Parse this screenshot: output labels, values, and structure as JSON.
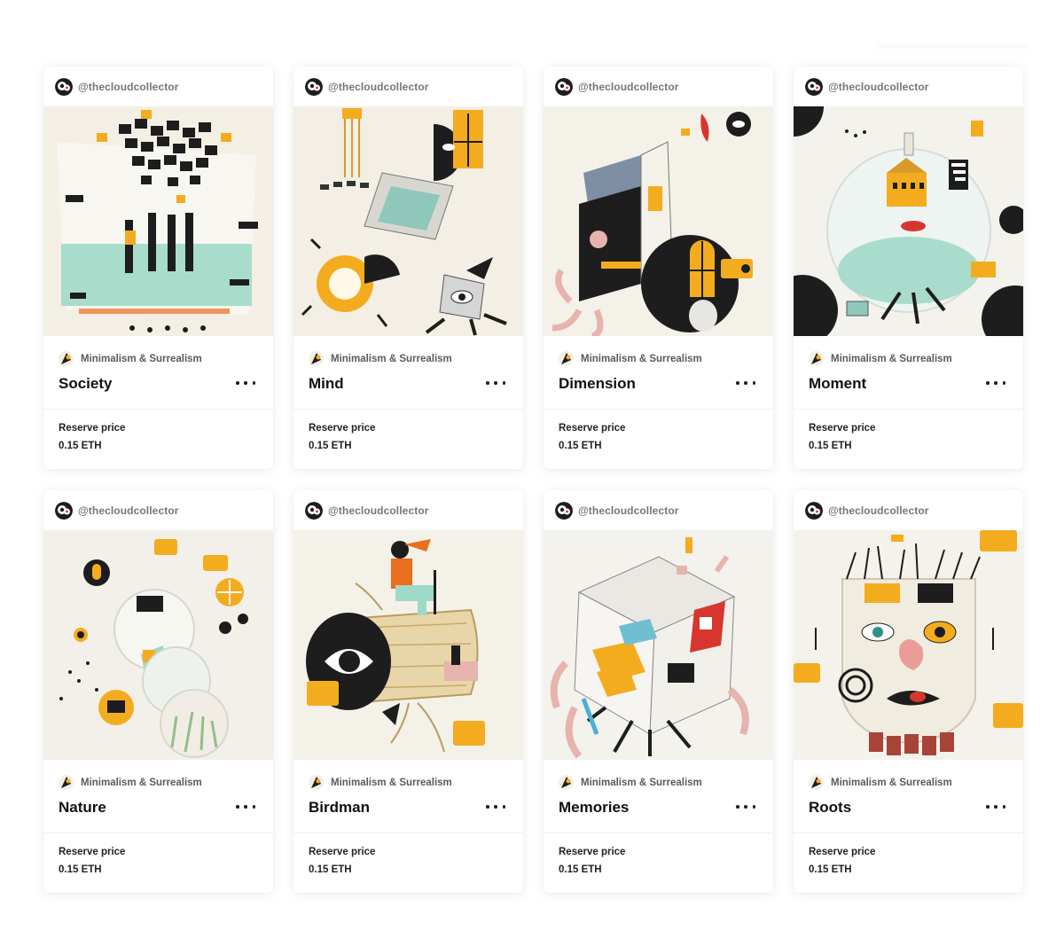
{
  "colors": {
    "cream": "#f3efe4",
    "yellow": "#f4ac1f",
    "black": "#1d1d1d",
    "mint": "#9fd9c8",
    "red": "#d9352f",
    "pink": "#e7b3ad"
  },
  "cards": [
    {
      "creator": "@thecloudcollector",
      "collection": "Minimalism & Surrealism",
      "title": "Society",
      "price_label": "Reserve price",
      "price": "0.15 ETH",
      "art_icon": "society-artwork"
    },
    {
      "creator": "@thecloudcollector",
      "collection": "Minimalism & Surrealism",
      "title": "Mind",
      "price_label": "Reserve price",
      "price": "0.15 ETH",
      "art_icon": "mind-artwork"
    },
    {
      "creator": "@thecloudcollector",
      "collection": "Minimalism & Surrealism",
      "title": "Dimension",
      "price_label": "Reserve price",
      "price": "0.15 ETH",
      "art_icon": "dimension-artwork"
    },
    {
      "creator": "@thecloudcollector",
      "collection": "Minimalism & Surrealism",
      "title": "Moment",
      "price_label": "Reserve price",
      "price": "0.15 ETH",
      "art_icon": "moment-artwork"
    },
    {
      "creator": "@thecloudcollector",
      "collection": "Minimalism & Surrealism",
      "title": "Nature",
      "price_label": "Reserve price",
      "price": "0.15 ETH",
      "art_icon": "nature-artwork"
    },
    {
      "creator": "@thecloudcollector",
      "collection": "Minimalism & Surrealism",
      "title": "Birdman",
      "price_label": "Reserve price",
      "price": "0.15 ETH",
      "art_icon": "birdman-artwork"
    },
    {
      "creator": "@thecloudcollector",
      "collection": "Minimalism & Surrealism",
      "title": "Memories",
      "price_label": "Reserve price",
      "price": "0.15 ETH",
      "art_icon": "memories-artwork"
    },
    {
      "creator": "@thecloudcollector",
      "collection": "Minimalism & Surrealism",
      "title": "Roots",
      "price_label": "Reserve price",
      "price": "0.15 ETH",
      "art_icon": "roots-artwork"
    }
  ]
}
